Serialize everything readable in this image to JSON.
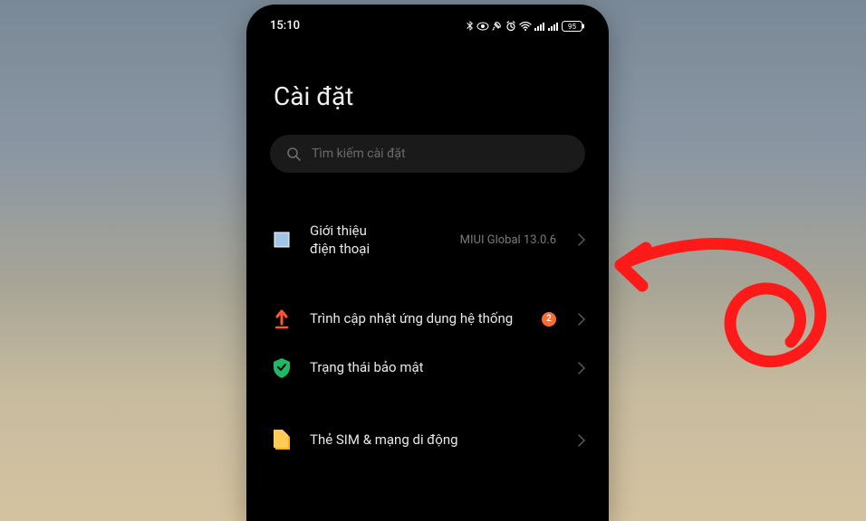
{
  "status": {
    "time": "15:10",
    "battery": "95"
  },
  "page": {
    "title": "Cài đặt"
  },
  "search": {
    "placeholder": "Tìm kiếm cài đặt"
  },
  "items": {
    "about": {
      "label": "Giới thiệu\nđiện thoại",
      "value": "MIUI Global 13.0.6"
    },
    "updater": {
      "label": "Trình cập nhật ứng dụng hệ thống",
      "badge": "2"
    },
    "security": {
      "label": "Trạng thái bảo mật"
    },
    "sim": {
      "label": "Thẻ SIM & mạng di động"
    }
  }
}
